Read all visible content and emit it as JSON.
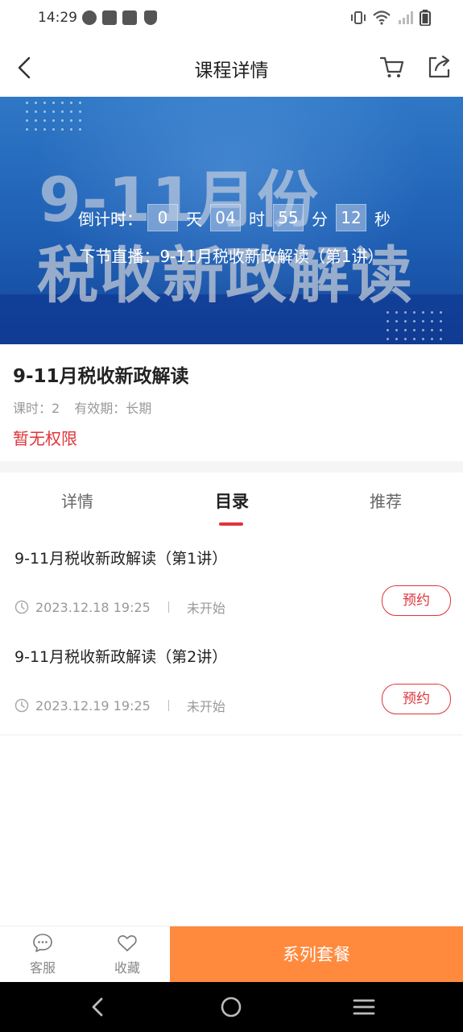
{
  "status_bar": {
    "time": "14:29"
  },
  "nav": {
    "title": "课程详情"
  },
  "banner": {
    "bg_title_line1": "9-11月份",
    "bg_title_line2": "税收新政解读",
    "live_label": "下节直播：",
    "live_lesson": "9-11月税收新政解读（第1讲）",
    "countdown_label": "倒计时：",
    "days": "0",
    "days_unit": "天",
    "hours": "04",
    "hours_unit": "时",
    "minutes": "55",
    "minutes_unit": "分",
    "seconds": "12",
    "seconds_unit": "秒"
  },
  "course": {
    "title": "9-11月税收新政解读",
    "hours_label": "课时：2",
    "validity_label": "有效期：长期",
    "permission_status": "暂无权限"
  },
  "tabs": [
    {
      "label": "详情",
      "active": false
    },
    {
      "label": "目录",
      "active": true
    },
    {
      "label": "推荐",
      "active": false
    }
  ],
  "lessons": [
    {
      "title": "9-11月税收新政解读（第1讲）",
      "datetime": "2023.12.18 19:25",
      "status": "未开始",
      "action": "预约"
    },
    {
      "title": "9-11月税收新政解读（第2讲）",
      "datetime": "2023.12.19 19:25",
      "status": "未开始",
      "action": "预约"
    }
  ],
  "action_bar": {
    "service_label": "客服",
    "favorite_label": "收藏",
    "package_label": "系列套餐"
  },
  "colors": {
    "accent_red": "#e0343a",
    "package_orange": "#ff8a3d",
    "banner_blue": "#1e5fb4"
  }
}
